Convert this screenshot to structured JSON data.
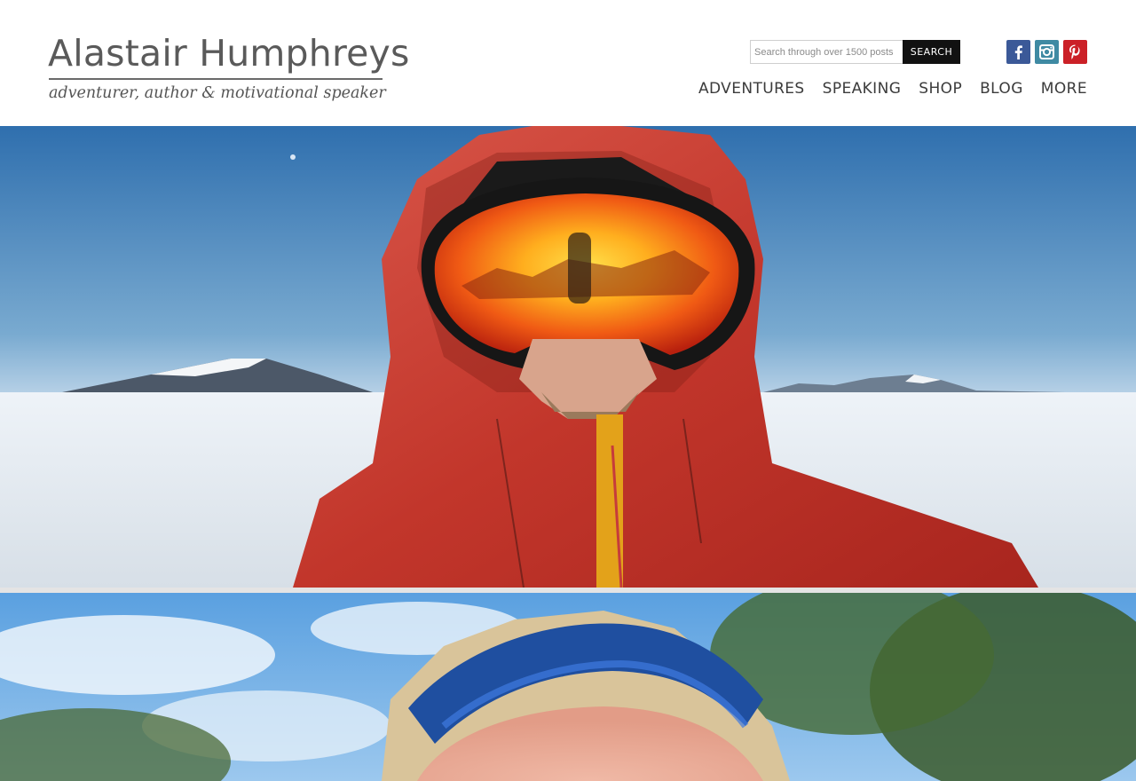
{
  "site": {
    "title": "Alastair Humphreys",
    "tagline": "adventurer, author & motivational speaker"
  },
  "search": {
    "placeholder": "Search through over 1500 posts",
    "button_label": "SEARCH"
  },
  "social": [
    {
      "icon": "facebook-icon",
      "color": "#3b5998"
    },
    {
      "icon": "instagram-icon",
      "color": "#3f8aa3"
    },
    {
      "icon": "pinterest-icon",
      "color": "#cb2027"
    }
  ],
  "nav": {
    "items": [
      "ADVENTURES",
      "SPEAKING",
      "SHOP",
      "BLOG",
      "MORE"
    ]
  },
  "hero_images": [
    {
      "subject": "portrait-red-hood-mirrored-goggles-snow"
    },
    {
      "subject": "portrait-blue-goggles-trees"
    }
  ]
}
